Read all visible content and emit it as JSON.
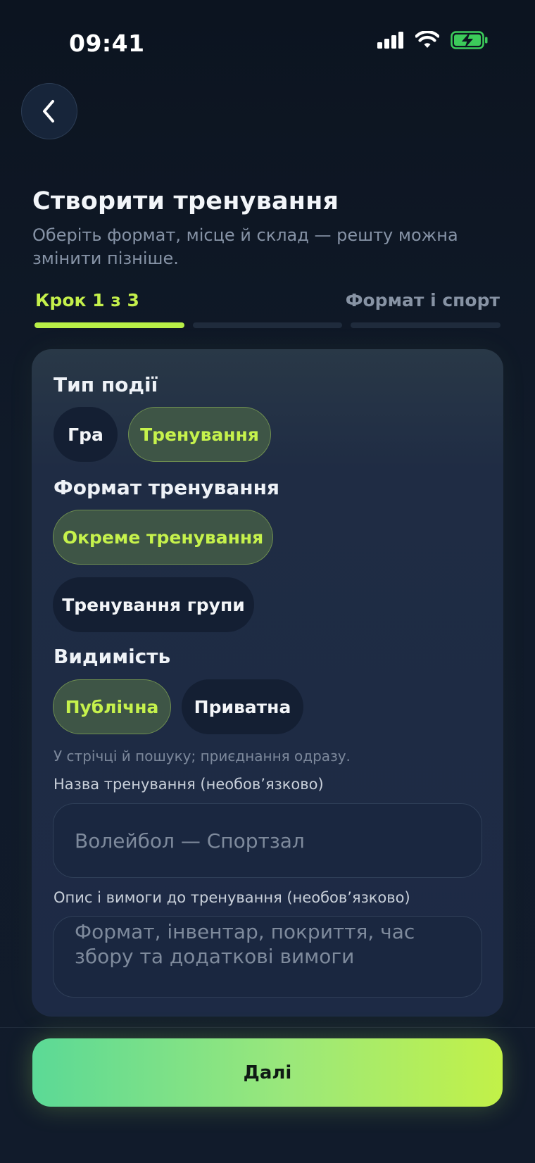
{
  "status_bar": {
    "time": "09:41",
    "icons": [
      "signal-icon",
      "wifi-icon",
      "battery-charging-icon"
    ],
    "battery_color": "#3ccb5a"
  },
  "header": {
    "back_icon": "chevron-left-icon",
    "title": "Створити тренування",
    "subtitle": "Оберіть формат, місце й склад — решту можна змінити пізніше."
  },
  "stepper": {
    "label": "Крок 1 з 3",
    "step_name": "Формат і спорт",
    "current": 1,
    "total": 3,
    "accent": "#b8ef47"
  },
  "form": {
    "event_type": {
      "label": "Тип події",
      "options": [
        "Гра",
        "Тренування"
      ],
      "selected": "Тренування"
    },
    "training_format": {
      "label": "Формат тренування",
      "options": [
        "Окреме тренування",
        "Тренування групи"
      ],
      "selected": "Окреме тренування"
    },
    "visibility": {
      "label": "Видимість",
      "options": [
        "Публічна",
        "Приватна"
      ],
      "selected": "Публічна",
      "hint": "У стрічці й пошуку; приєднання одразу."
    },
    "name": {
      "label": "Назва тренування (необов’язково)",
      "value": "",
      "placeholder": "Волейбол — Спортзал"
    },
    "description": {
      "label": "Опис і вимоги до тренування (необов’язково)",
      "value": "",
      "placeholder": "Формат, інвентар, покриття, час збору та додаткові вимоги"
    }
  },
  "footer": {
    "next_label": "Далі"
  },
  "colors": {
    "selected_chip_text": "#c6f24c",
    "selected_chip_bg": "#3e5546",
    "unselected_chip_bg": "#141f33",
    "button_gradient_start": "#5bd996",
    "button_gradient_end": "#c2f148"
  }
}
